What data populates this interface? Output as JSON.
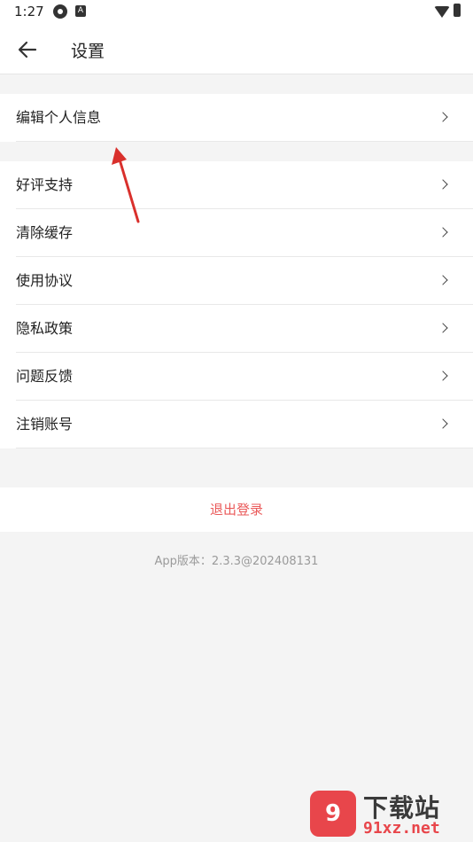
{
  "status_bar": {
    "time": "1:27",
    "icons": [
      "notification-icon",
      "a-icon",
      "wifi-icon",
      "battery-icon"
    ]
  },
  "header": {
    "title": "设置",
    "back_icon": "back-arrow-icon"
  },
  "groups": [
    {
      "items": [
        {
          "label": "编辑个人信息"
        }
      ]
    },
    {
      "items": [
        {
          "label": "好评支持"
        },
        {
          "label": "清除缓存"
        },
        {
          "label": "使用协议"
        },
        {
          "label": "隐私政策"
        },
        {
          "label": "问题反馈"
        },
        {
          "label": "注销账号"
        }
      ]
    }
  ],
  "logout": {
    "label": "退出登录"
  },
  "version": {
    "text": "App版本：2.3.3@202408131"
  },
  "colors": {
    "accent": "#ea5a5a",
    "background": "#f4f4f4",
    "card": "#ffffff"
  },
  "watermark": {
    "logo": "9",
    "title": "下载站",
    "site": "91xz.net"
  }
}
